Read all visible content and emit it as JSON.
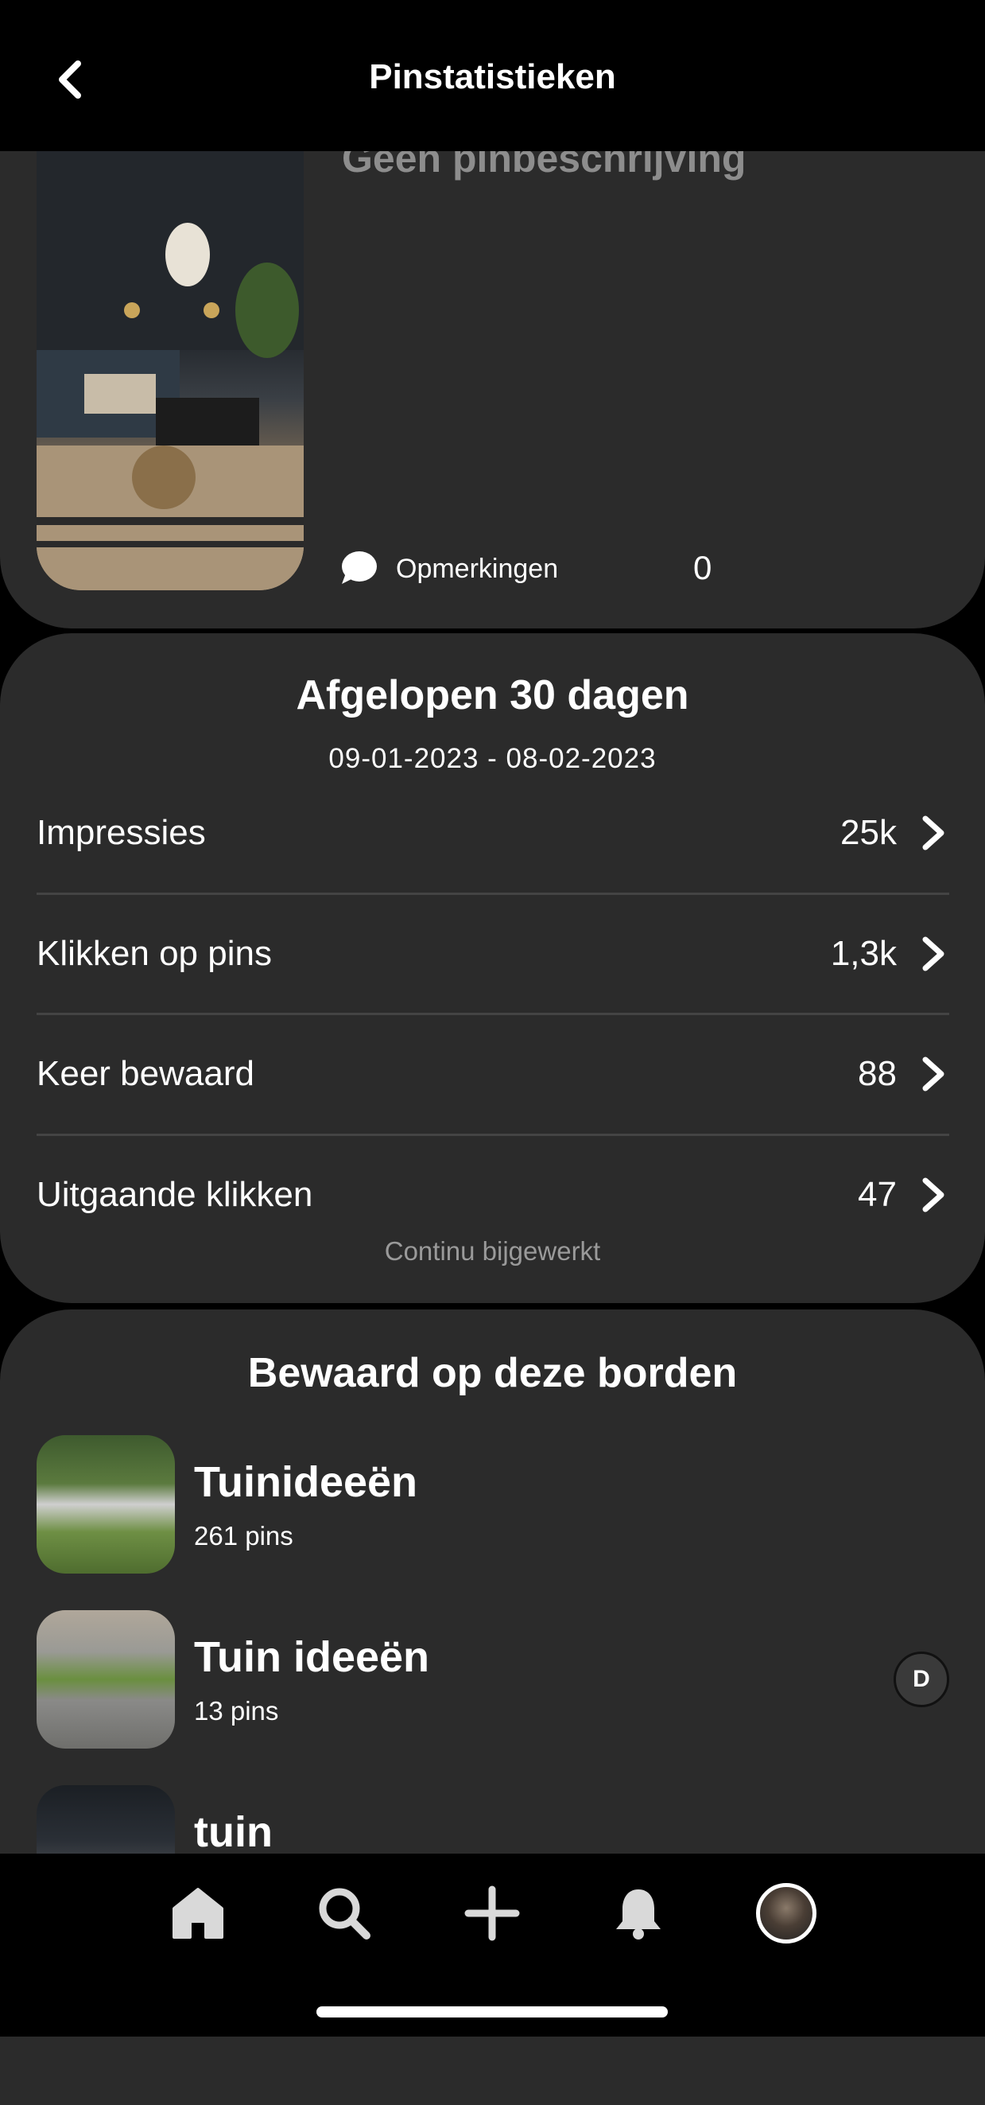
{
  "header": {
    "title": "Pinstatistieken"
  },
  "pin": {
    "description": "Geen pinbeschrijving",
    "comments_label": "Opmerkingen",
    "comments_count": "0"
  },
  "stats": {
    "title": "Afgelopen 30 dagen",
    "date_range": "09-01-2023 - 08-02-2023",
    "rows": [
      {
        "label": "Impressies",
        "value": "25k"
      },
      {
        "label": "Klikken op pins",
        "value": "1,3k"
      },
      {
        "label": "Keer bewaard",
        "value": "88"
      },
      {
        "label": "Uitgaande klikken",
        "value": "47"
      }
    ],
    "footer": "Continu bijgewerkt"
  },
  "boards": {
    "title": "Bewaard op deze borden",
    "items": [
      {
        "name": "Tuinideeën",
        "count": "261 pins"
      },
      {
        "name": "Tuin ideeën",
        "count": "13 pins",
        "avatar_initial": "D"
      },
      {
        "name": "tuin",
        "count": ""
      }
    ]
  },
  "nav": {
    "items": [
      "home-icon",
      "search-icon",
      "add-icon",
      "notifications-icon",
      "profile-avatar"
    ]
  }
}
